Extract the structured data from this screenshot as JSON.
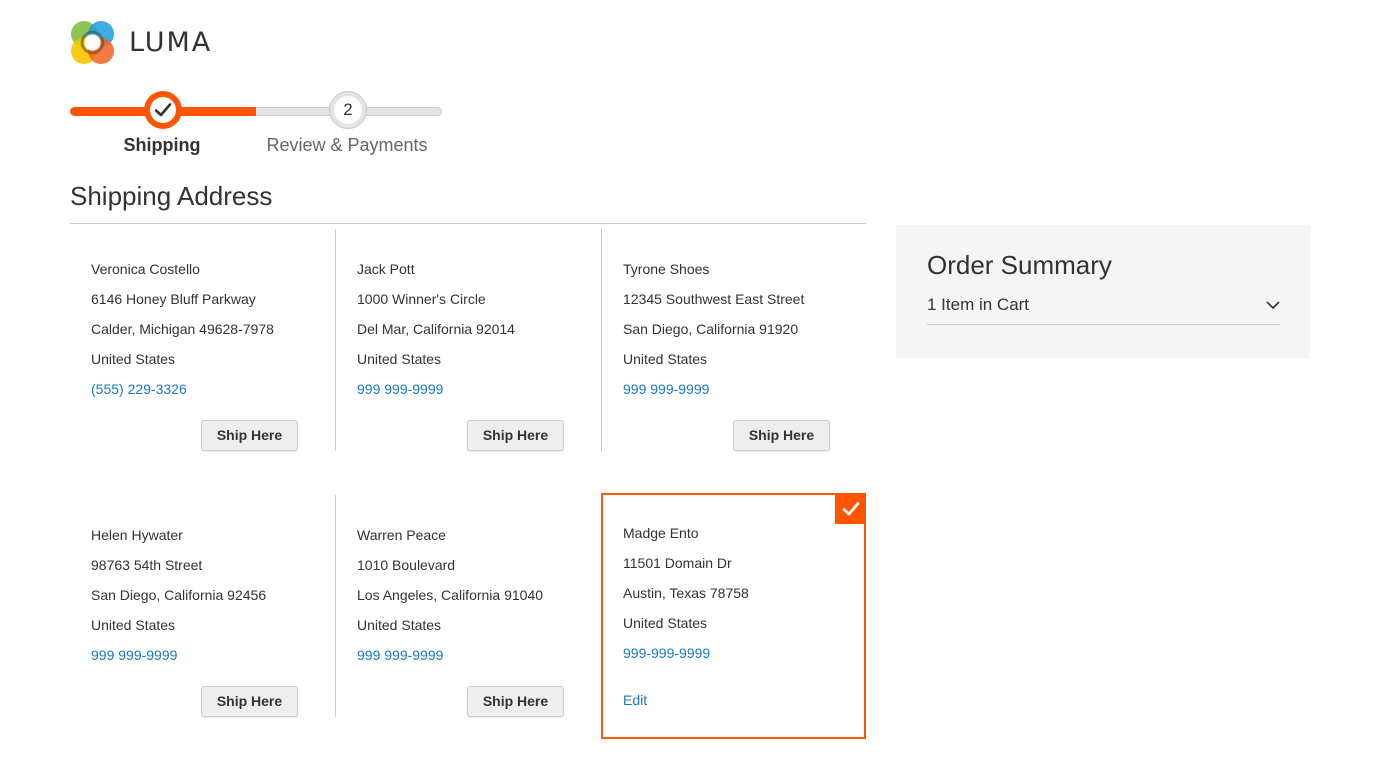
{
  "brand": {
    "name": "LUMA"
  },
  "progress": {
    "steps": [
      {
        "label": "Shipping",
        "state": "complete"
      },
      {
        "label": "Review & Payments",
        "number": "2",
        "state": "pending"
      }
    ]
  },
  "shipping": {
    "title": "Shipping Address",
    "ship_button_label": "Ship Here",
    "edit_label": "Edit",
    "addresses": [
      {
        "name": "Veronica Costello",
        "street": "6146 Honey Bluff Parkway",
        "city": "Calder, Michigan 49628-7978",
        "country": "United States",
        "phone": "(555) 229-3326"
      },
      {
        "name": "Jack Pott",
        "street": "1000 Winner's Circle",
        "city": "Del Mar, California 92014",
        "country": "United States",
        "phone": "999 999-9999"
      },
      {
        "name": "Tyrone Shoes",
        "street": "12345 Southwest East Street",
        "city": "San Diego, California 91920",
        "country": "United States",
        "phone": "999 999-9999"
      },
      {
        "name": "Helen Hywater",
        "street": "98763 54th Street",
        "city": "San Diego, California 92456",
        "country": "United States",
        "phone": "999 999-9999"
      },
      {
        "name": "Warren Peace",
        "street": "1010 Boulevard",
        "city": "Los Angeles, California 91040",
        "country": "United States",
        "phone": "999 999-9999"
      },
      {
        "name": "Madge Ento",
        "street": "11501 Domain Dr",
        "city": "Austin, Texas 78758",
        "country": "United States",
        "phone": "999-999-9999",
        "selected": true
      }
    ]
  },
  "summary": {
    "title": "Order Summary",
    "items_label": "1 Item in Cart"
  },
  "colors": {
    "accent": "#ff5501",
    "link": "#1979c3"
  }
}
